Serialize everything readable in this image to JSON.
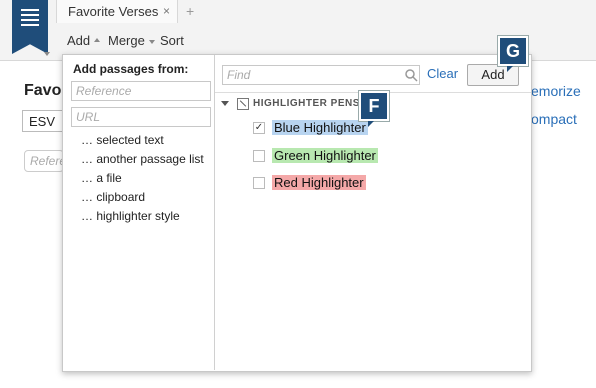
{
  "app": {
    "tab_title": "Favorite Verses",
    "tab_close": "×",
    "tab_add": "+"
  },
  "toolbar": {
    "add_label": "Add",
    "merge_label": "Merge",
    "sort_label": "Sort"
  },
  "background": {
    "title": "Favo",
    "version": "ESV",
    "reference_placeholder": "Refere",
    "memorize_link": "emorize",
    "compact_link": "ompact"
  },
  "dropdown": {
    "heading": "Add passages from:",
    "reference_placeholder": "Reference",
    "url_placeholder": "URL",
    "sources": [
      "… selected text",
      "… another passage list",
      "… a file",
      "… clipboard",
      "… highlighter style"
    ]
  },
  "highlighter_panel": {
    "find_placeholder": "Find",
    "clear_label": "Clear",
    "add_button": "Add",
    "group_label": "HIGHLIGHTER PENS",
    "items": [
      {
        "label": "Blue Highlighter",
        "checked": true,
        "color": "#b8d4f0"
      },
      {
        "label": "Green Highlighter",
        "checked": false,
        "color": "#b8e8b0"
      },
      {
        "label": "Red Highlighter",
        "checked": false,
        "color": "#f4a8a8"
      }
    ]
  },
  "callouts": {
    "g": "G",
    "f": "F"
  },
  "colors": {
    "brand": "#1f4d7a",
    "link": "#2a6fb8"
  }
}
